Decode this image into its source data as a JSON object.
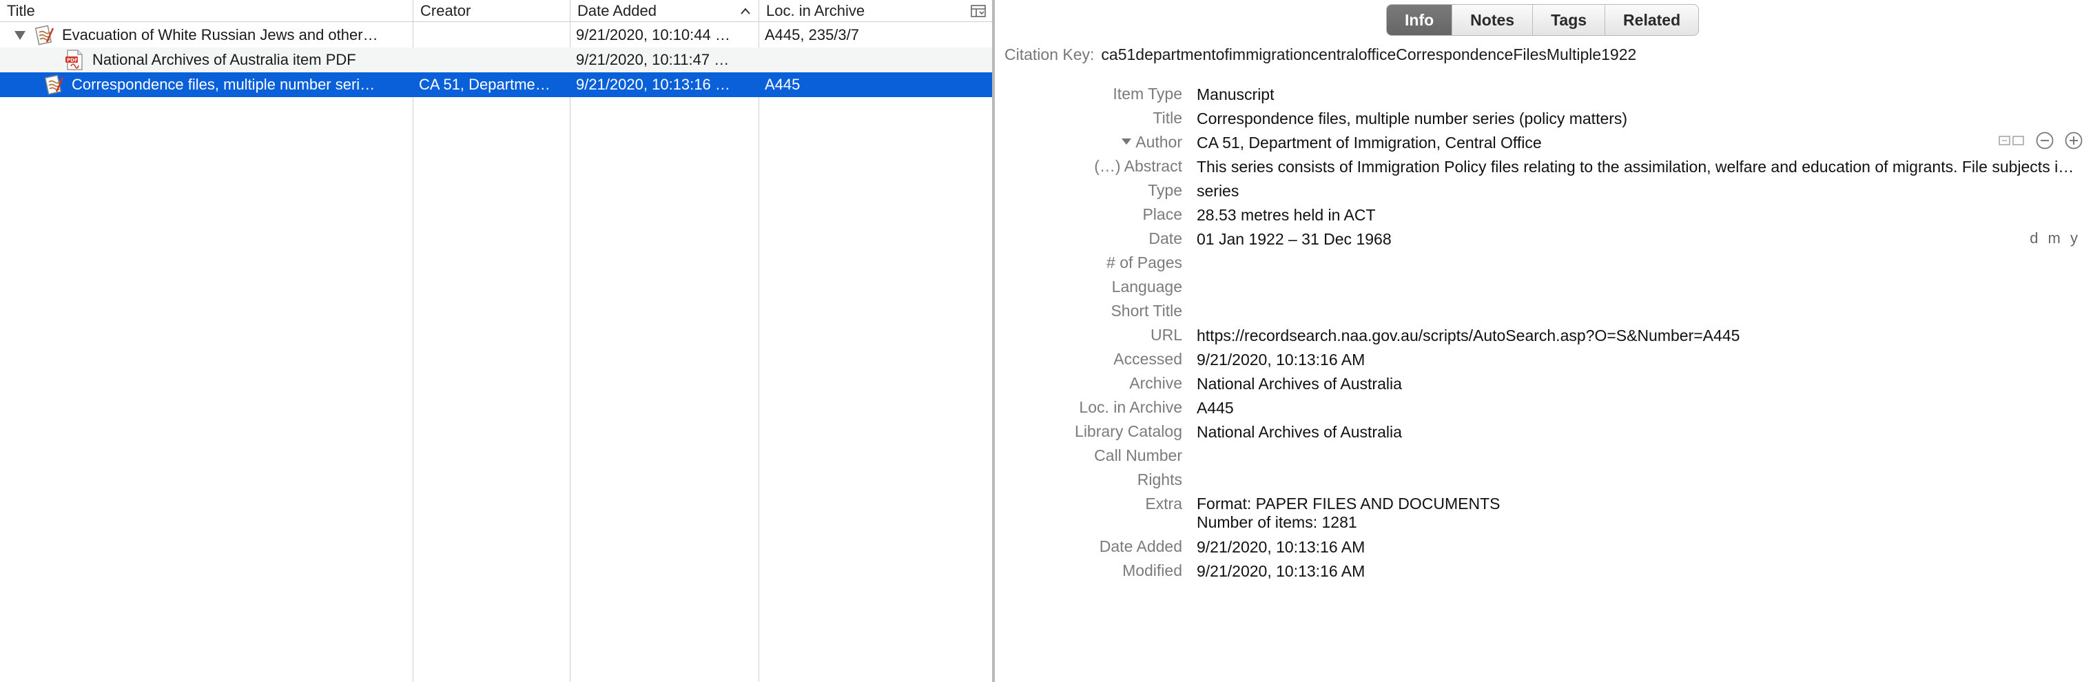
{
  "list": {
    "columns": {
      "title": "Title",
      "creator": "Creator",
      "date_added": "Date Added",
      "loc_in_archive": "Loc. in Archive"
    },
    "rows": [
      {
        "title": "Evacuation of White Russian Jews and other…",
        "creator": "",
        "date_added": "9/21/2020, 10:10:44 …",
        "loc": "A445, 235/3/7",
        "icon": "manuscript-icon",
        "expanded": true
      },
      {
        "title": "National Archives of Australia item PDF",
        "creator": "",
        "date_added": "9/21/2020, 10:11:47 …",
        "loc": "",
        "icon": "pdf-icon"
      },
      {
        "title": "Correspondence files, multiple number seri…",
        "creator": "CA 51, Departme…",
        "date_added": "9/21/2020, 10:13:16 …",
        "loc": "A445",
        "icon": "manuscript-icon",
        "selected": true
      }
    ]
  },
  "info": {
    "tabs": [
      "Info",
      "Notes",
      "Tags",
      "Related"
    ],
    "active_tab": "Info",
    "citation_key_label": "Citation Key:",
    "citation_key": "ca51departmentofimmigrationcentralofficeCorrespondenceFilesMultiple1922",
    "fields": {
      "item_type": {
        "label": "Item Type",
        "value": "Manuscript"
      },
      "title": {
        "label": "Title",
        "value": "Correspondence files, multiple number series (policy matters)"
      },
      "author": {
        "label": "Author",
        "value": "CA 51, Department of Immigration, Central Office"
      },
      "abstract": {
        "label": "(…) Abstract",
        "value": "This series consists of Immigration Policy files relating to the assimilation, welfare and education of migrants. File subjects incl…"
      },
      "type": {
        "label": "Type",
        "value": "series"
      },
      "place": {
        "label": "Place",
        "value": "28.53 metres held in ACT"
      },
      "date": {
        "label": "Date",
        "value": "01 Jan 1922 – 31 Dec 1968",
        "format": "d m y"
      },
      "pages": {
        "label": "# of Pages",
        "value": ""
      },
      "language": {
        "label": "Language",
        "value": ""
      },
      "short_title": {
        "label": "Short Title",
        "value": ""
      },
      "url": {
        "label": "URL",
        "value": "https://recordsearch.naa.gov.au/scripts/AutoSearch.asp?O=S&Number=A445"
      },
      "accessed": {
        "label": "Accessed",
        "value": "9/21/2020, 10:13:16 AM"
      },
      "archive": {
        "label": "Archive",
        "value": "National Archives of Australia"
      },
      "loc_in_archive": {
        "label": "Loc. in Archive",
        "value": "A445"
      },
      "library_catalog": {
        "label": "Library Catalog",
        "value": "National Archives of Australia"
      },
      "call_number": {
        "label": "Call Number",
        "value": ""
      },
      "rights": {
        "label": "Rights",
        "value": ""
      },
      "extra": {
        "label": "Extra",
        "line1": "Format: PAPER FILES AND DOCUMENTS",
        "line2": "Number of items: 1281"
      },
      "date_added": {
        "label": "Date Added",
        "value": "9/21/2020, 10:13:16 AM"
      },
      "modified": {
        "label": "Modified",
        "value": "9/21/2020, 10:13:16 AM"
      }
    }
  },
  "colors": {
    "selection": "#0a60d8",
    "active_tab": "#6e6e6e",
    "label_gray": "#7b7b7b"
  }
}
